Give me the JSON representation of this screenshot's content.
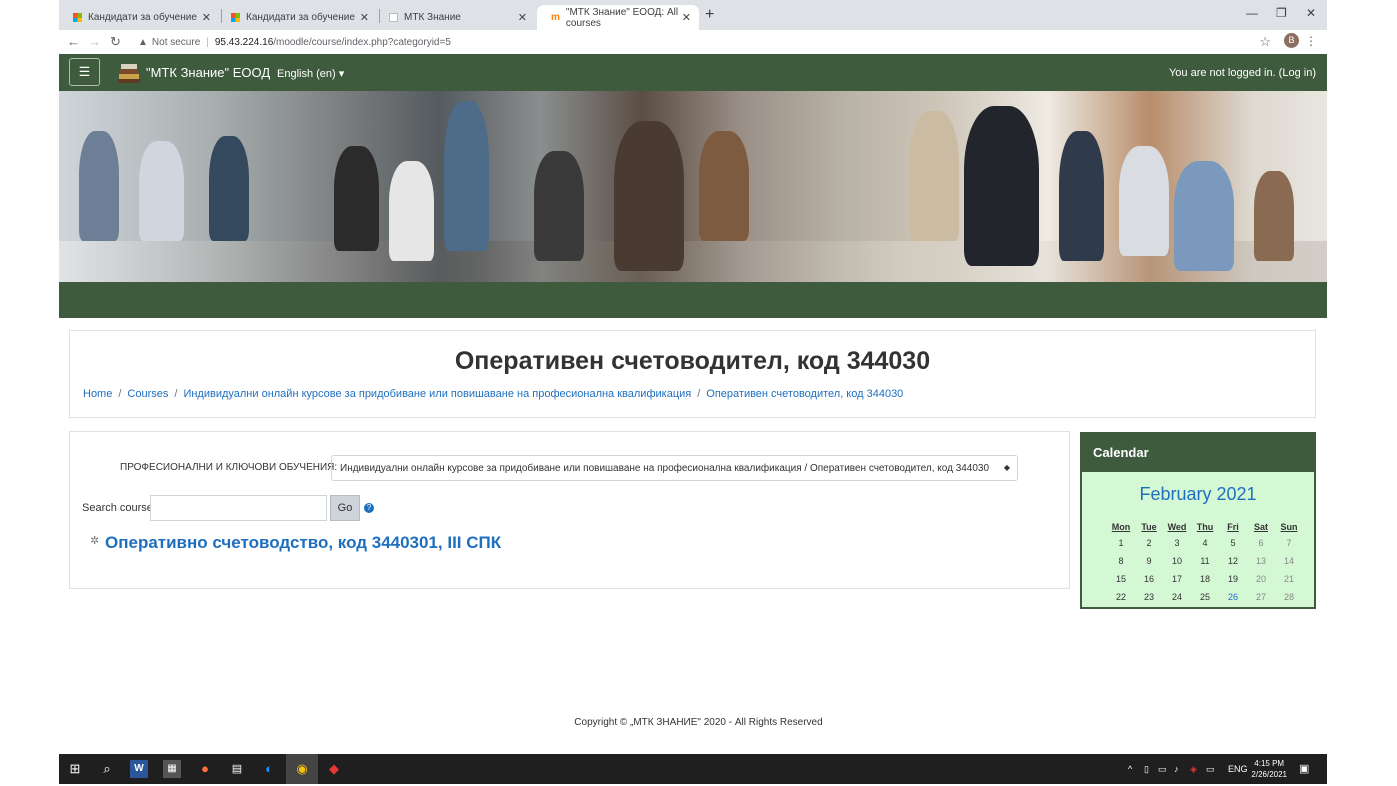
{
  "browser": {
    "tabs": [
      {
        "title": "Кандидати за обучение",
        "active": false
      },
      {
        "title": "Кандидати за обучение",
        "active": false
      },
      {
        "title": "МТК Знание",
        "active": false
      },
      {
        "title": "\"МТК Знание\" ЕООД: All courses",
        "active": true
      }
    ],
    "security_label": "Not secure",
    "url_host": "95.43.224.16",
    "url_path": "/moodle/course/index.php?categoryid=5",
    "profile_initial": "B"
  },
  "site": {
    "name": "\"МТК Знание\" ЕООД",
    "language": "English (en)",
    "login_prefix": "You are not logged in. (",
    "login_link": "Log in",
    "login_suffix": ")",
    "brand_color": "#3f5b3e"
  },
  "page": {
    "title": "Оперативен счетоводител, код 344030",
    "breadcrumb": [
      "Home",
      "Courses",
      "Индивидуални онлайн курсове за придобиване или повишаване на професионална квалификация",
      "Оперативен счетоводител, код 344030"
    ]
  },
  "main": {
    "category_label": "ПРОФЕСИОНАЛНИ И КЛЮЧОВИ ОБУЧЕНИЯ:",
    "category_value": "Индивидуални онлайн курсове за придобиване или повишаване на професионална квалификация / Оперативен счетоводител, код 344030",
    "search_label": "Search courses",
    "search_value": "",
    "go_label": "Go",
    "course_title": "Оперативно счетоводство, код 3440301, III СПК"
  },
  "calendar": {
    "block_title": "Calendar",
    "month": "February 2021",
    "weekdays": [
      "Mon",
      "Tue",
      "Wed",
      "Thu",
      "Fri",
      "Sat",
      "Sun"
    ],
    "weeks": [
      [
        "1",
        "2",
        "3",
        "4",
        "5",
        "6",
        "7"
      ],
      [
        "8",
        "9",
        "10",
        "11",
        "12",
        "13",
        "14"
      ],
      [
        "15",
        "16",
        "17",
        "18",
        "19",
        "20",
        "21"
      ],
      [
        "22",
        "23",
        "24",
        "25",
        "26",
        "27",
        "28"
      ]
    ],
    "today": "26"
  },
  "footer": {
    "copyright": "Copyright © „МТК ЗНАНИЕ\" 2020 - All Rights Reserved"
  },
  "taskbar": {
    "language": "ENG",
    "time": "4:15 PM",
    "date": "2/26/2021"
  }
}
